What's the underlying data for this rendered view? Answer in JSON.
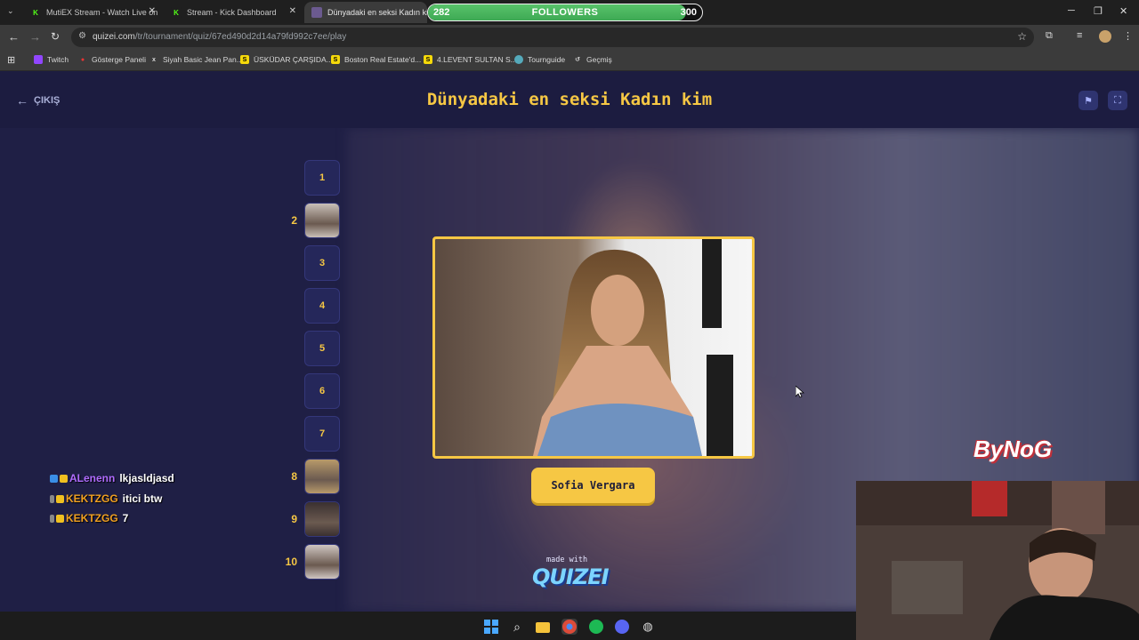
{
  "tabs": [
    {
      "title": "MutiEX Stream - Watch Live on"
    },
    {
      "title": "Stream - Kick Dashboard"
    },
    {
      "title": "Dünyadaki en seksi Kadın kim"
    }
  ],
  "followers": {
    "current": "282",
    "label": "FOLLOWERS",
    "goal": "300",
    "progress": 0.94
  },
  "address": {
    "domain": "quizei.com",
    "path": "/tr/tournament/quiz/67ed490d2d14a79fd992c7ee/play"
  },
  "bookmarks": [
    {
      "label": "Twitch"
    },
    {
      "label": "Gösterge Paneli"
    },
    {
      "label": "Siyah Basic Jean Pan..."
    },
    {
      "label": "ÜSKÜDAR ÇARŞIDA..."
    },
    {
      "label": "Boston Real Estate'd..."
    },
    {
      "label": "4.LEVENT SULTAN S..."
    },
    {
      "label": "Tournguide"
    },
    {
      "label": "Geçmiş"
    }
  ],
  "page": {
    "exit_label": "ÇIKIŞ",
    "title": "Dünyadaki en seksi Kadın kim",
    "current_name": "Sofia Vergara",
    "made_with": "made with",
    "logo": "QUIZEI"
  },
  "ranks": [
    {
      "n": "1",
      "slot": "1",
      "filled": false
    },
    {
      "n": "2",
      "slot": "",
      "filled": true
    },
    {
      "n": "3",
      "slot": "3",
      "filled": false
    },
    {
      "n": "4",
      "slot": "4",
      "filled": false
    },
    {
      "n": "5",
      "slot": "5",
      "filled": false
    },
    {
      "n": "6",
      "slot": "6",
      "filled": false
    },
    {
      "n": "7",
      "slot": "7",
      "filled": false
    },
    {
      "n": "8",
      "slot": "",
      "filled": true
    },
    {
      "n": "9",
      "slot": "",
      "filled": true
    },
    {
      "n": "10",
      "slot": "",
      "filled": true
    }
  ],
  "chat": [
    {
      "user": "ALenenn",
      "message": "lkjasldjasd",
      "color": "#b06cff"
    },
    {
      "user": "KEKTZGG",
      "message": "itici btw",
      "color": "#f0a020"
    },
    {
      "user": "KEKTZGG",
      "message": "7",
      "color": "#f0a020"
    }
  ],
  "overlay_logo": "ByNoG",
  "colors": {
    "accent": "#f6c744",
    "page_bg": "#1f1f45",
    "header_bg": "#1c1c40"
  }
}
